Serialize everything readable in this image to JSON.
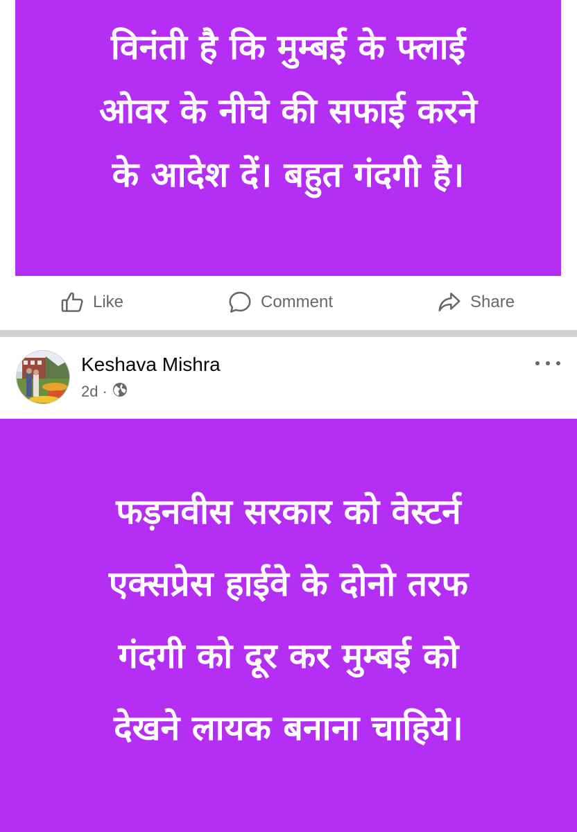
{
  "post1": {
    "text": "विनंती है कि मुम्बई के    फ्लाई\nओवर के नीचे की सफाई करने\nके आदेश दें। बहुत गंदगी है।",
    "background_color": "#b42ef3"
  },
  "actions": {
    "like_label": "Like",
    "comment_label": "Comment",
    "share_label": "Share"
  },
  "post2": {
    "author": "Keshava Mishra",
    "time": "2d",
    "separator_dot": "·",
    "privacy_icon": "globe-icon",
    "more_icon": "more-options-icon",
    "text": "फड़नवीस सरकार को वेस्टर्न\nएक्सप्रेस हाईवे के दोनो तरफ\nगंदगी को दूर कर मुम्बई को\nदेखने लायक बनाना चाहिये।",
    "background_color": "#b42ef3"
  },
  "colors": {
    "accent_purple": "#b42ef3",
    "muted_text": "#65676b",
    "separator": "#ced0d4"
  }
}
